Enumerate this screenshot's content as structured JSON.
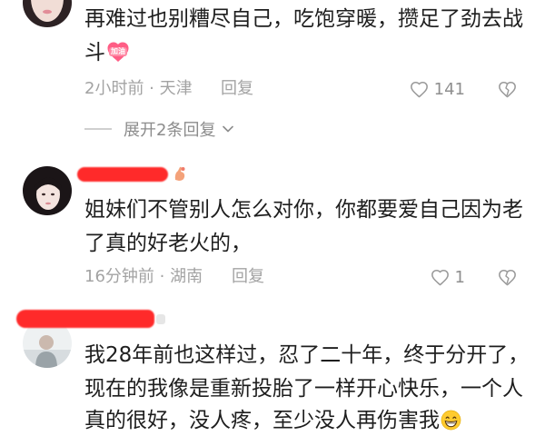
{
  "colors": {
    "text": "#1e1e1e",
    "meta": "#a3a3a3",
    "count": "#8f8f8f",
    "redaction": "#ff2a2a",
    "sticker": "#ff5d85",
    "grin": "#ffcb2f"
  },
  "icons": {
    "like": "heart-outline-icon",
    "dislike": "dislike-icon",
    "expand": "chevron-down-icon",
    "sticker": "jiayou-sticker-icon",
    "grin": "grin-emoji-icon"
  },
  "comments": [
    {
      "text_lines": [
        "再难过也别糟尽自己，吃饱穿暖，攒足了劲去战",
        "斗"
      ],
      "sticker": {
        "label": "加油"
      },
      "meta": "2小时前 · 天津",
      "reply_label": "回复",
      "like_count": "141",
      "expand_label": "展开2条回复"
    },
    {
      "text_lines": [
        "姐妹们不管别人怎么对你，你都要爱自己因为老",
        "了真的好老火的，"
      ],
      "meta": "16分钟前 · 湖南",
      "reply_label": "回复",
      "like_count": "1"
    },
    {
      "text_lines": [
        "我28年前也这样过，忍了二十年，终于分开了，",
        "现在的我像是重新投胎了一样开心快乐，一个人",
        "真的很好，没人疼，至少没人再伤害我"
      ]
    }
  ]
}
